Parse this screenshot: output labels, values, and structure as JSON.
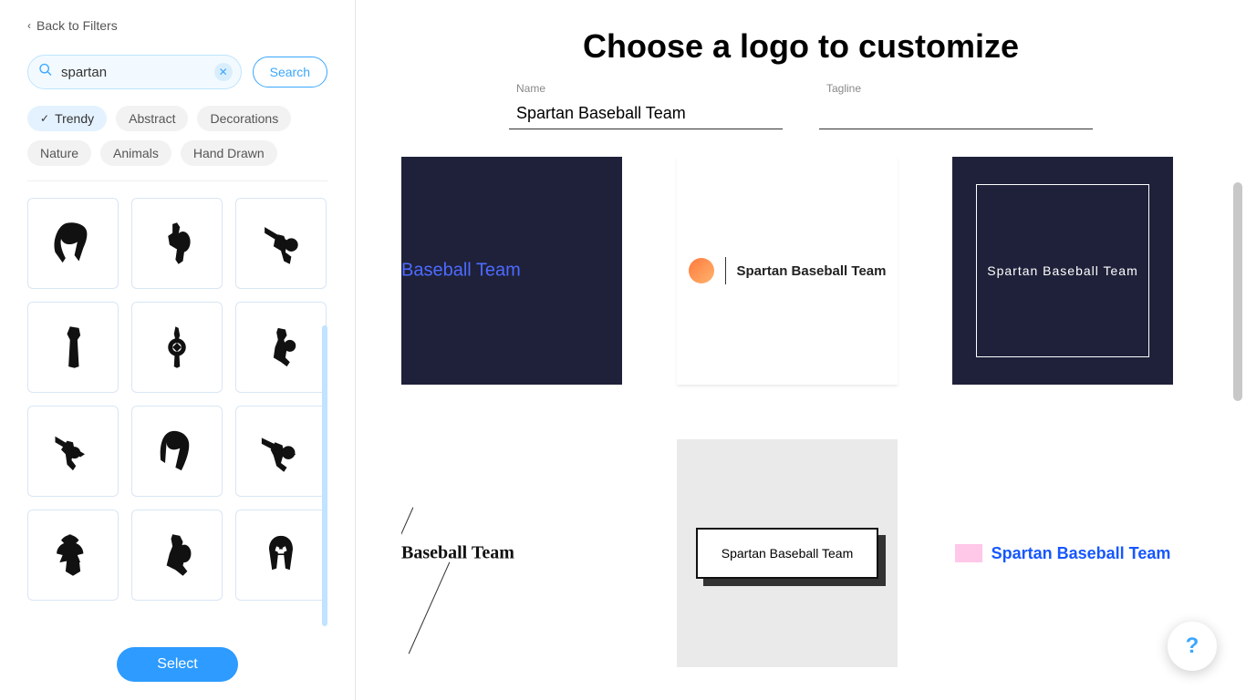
{
  "sidebar": {
    "back_label": "Back to Filters",
    "search_value": "spartan",
    "search_button": "Search",
    "chips": [
      "Trendy",
      "Abstract",
      "Decorations",
      "Nature",
      "Animals",
      "Hand Drawn"
    ],
    "active_chip": 0,
    "select_button": "Select"
  },
  "main": {
    "title": "Choose a logo to customize",
    "name_label": "Name",
    "name_value": "Spartan Baseball Team",
    "tagline_label": "Tagline",
    "tagline_value": "",
    "logo_text": "Spartan Baseball Team",
    "card1_text": "Baseball Team",
    "card4_text": "Baseball Team",
    "help_label": "?"
  }
}
